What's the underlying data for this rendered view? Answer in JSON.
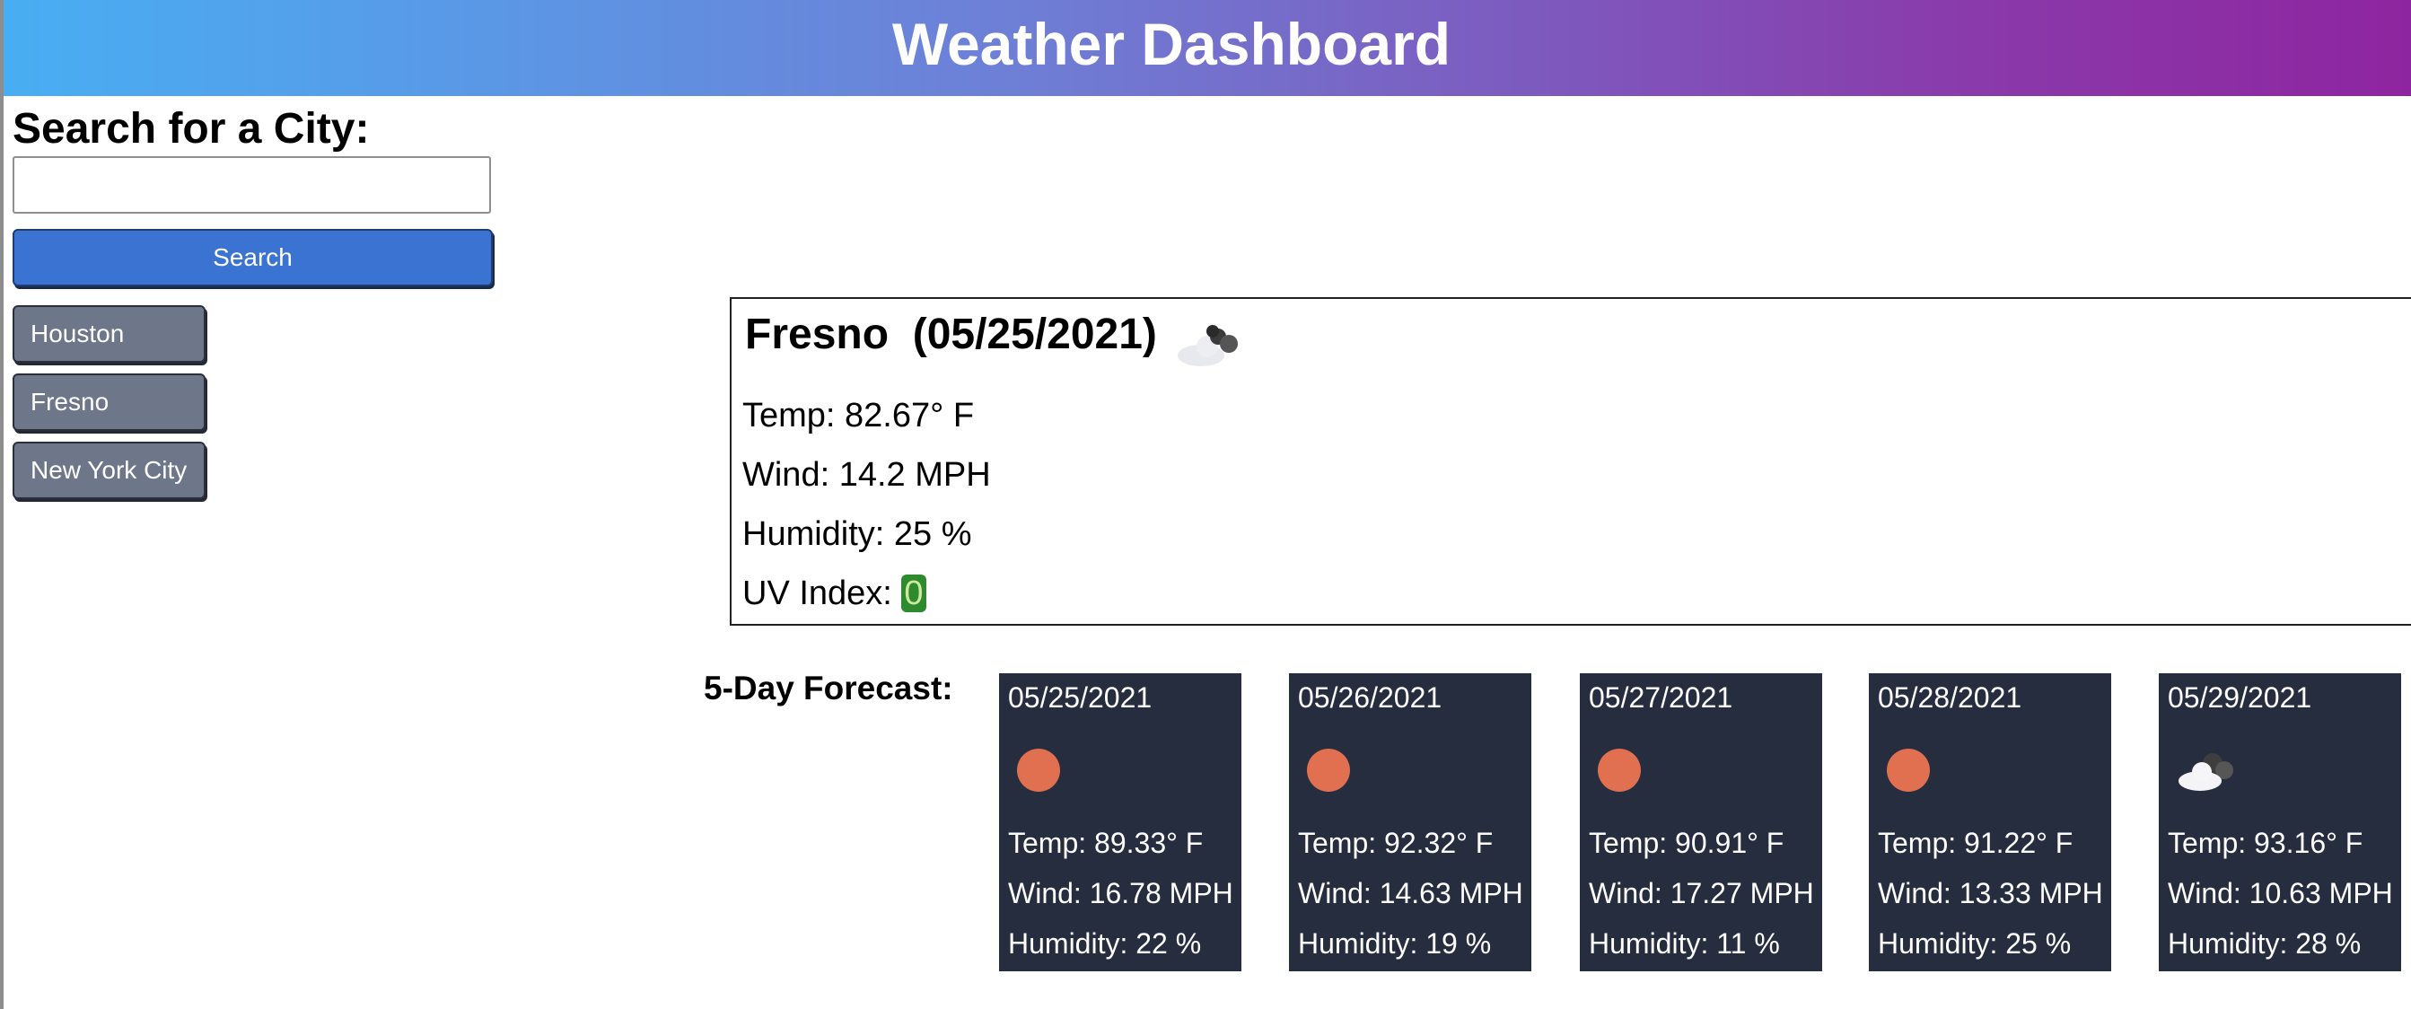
{
  "header": {
    "title": "Weather Dashboard"
  },
  "search": {
    "heading": "Search for a City:",
    "input_value": "",
    "placeholder": "",
    "button_label": "Search"
  },
  "history": [
    "Houston",
    "Fresno",
    "New York City"
  ],
  "current": {
    "city": "Fresno",
    "date": "(05/25/2021)",
    "icon": "broken-clouds-icon",
    "temp": "Temp: 82.67° F",
    "wind": "Wind: 14.2 MPH",
    "humidity": "Humidity: 25 %",
    "uv_label": "UV Index: ",
    "uv_value": "0",
    "uv_color": "#2d8a2f"
  },
  "forecast": {
    "heading": "5-Day Forecast:",
    "days": [
      {
        "date": "05/25/2021",
        "icon": "sun-icon",
        "temp": "Temp: 89.33° F",
        "wind": "Wind: 16.78 MPH",
        "humidity": "Humidity: 22 %"
      },
      {
        "date": "05/26/2021",
        "icon": "sun-icon",
        "temp": "Temp: 92.32° F",
        "wind": "Wind: 14.63 MPH",
        "humidity": "Humidity: 19 %"
      },
      {
        "date": "05/27/2021",
        "icon": "sun-icon",
        "temp": "Temp: 90.91° F",
        "wind": "Wind: 17.27 MPH",
        "humidity": "Humidity: 11 %"
      },
      {
        "date": "05/28/2021",
        "icon": "sun-icon",
        "temp": "Temp: 91.22° F",
        "wind": "Wind: 13.33 MPH",
        "humidity": "Humidity: 25 %"
      },
      {
        "date": "05/29/2021",
        "icon": "broken-clouds-icon",
        "temp": "Temp: 93.16° F",
        "wind": "Wind: 10.63 MPH",
        "humidity": "Humidity: 28 %"
      }
    ]
  },
  "colors": {
    "header_gradient_start": "#48aef3",
    "header_gradient_end": "#8e25a0",
    "search_button": "#3a73d1",
    "history_button": "#6e7689",
    "forecast_card": "#262d3f",
    "sun": "#e07050"
  }
}
